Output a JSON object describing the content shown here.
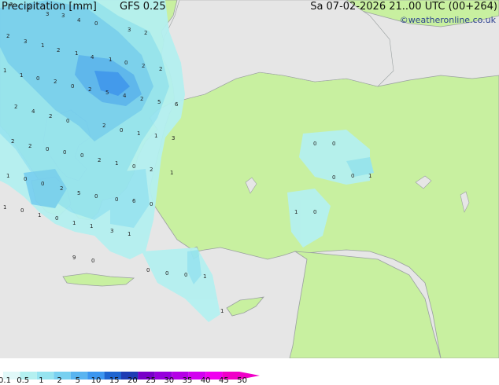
{
  "legend": {
    "title": "Precipitation [mm]",
    "model": "GFS 0.25",
    "valid": "Sa 07-02-2026 21..00 UTC (00+264)",
    "credit": "©weatheronline.co.uk",
    "ticks": [
      "0.1",
      "0.5",
      "1",
      "2",
      "5",
      "10",
      "15",
      "20",
      "25",
      "30",
      "35",
      "40",
      "45",
      "50"
    ],
    "colors": [
      "#e0f8f8",
      "#b4f0f0",
      "#96e4f0",
      "#78d0f0",
      "#5ab4f0",
      "#3c96f0",
      "#1e64d0",
      "#1e3cb4",
      "#7800c8",
      "#9600dc",
      "#b400e6",
      "#d200f0",
      "#f000f0",
      "#f000c8"
    ]
  },
  "map": {
    "land_color": "#c8f0a0",
    "sea_color": "#e6e6e6",
    "precip_labels": [
      "2",
      "2",
      "3",
      "3",
      "4",
      "0",
      "3",
      "2",
      "2",
      "3",
      "1",
      "2",
      "1",
      "4",
      "1",
      "0",
      "2",
      "2",
      "1",
      "1",
      "0",
      "2",
      "0",
      "2",
      "5",
      "4",
      "2",
      "5",
      "6",
      "2",
      "4",
      "2",
      "0",
      "2",
      "0",
      "1",
      "1",
      "3",
      "2",
      "2",
      "0",
      "0",
      "0",
      "2",
      "1",
      "0",
      "2",
      "1",
      "1",
      "0",
      "0",
      "2",
      "5",
      "0",
      "0",
      "6",
      "0",
      "1",
      "0",
      "1",
      "0",
      "1",
      "1",
      "3",
      "1",
      "9",
      "0",
      "0",
      "0",
      "0",
      "1",
      "0",
      "0",
      "0",
      "0",
      "1",
      "1",
      "0",
      "1"
    ]
  }
}
